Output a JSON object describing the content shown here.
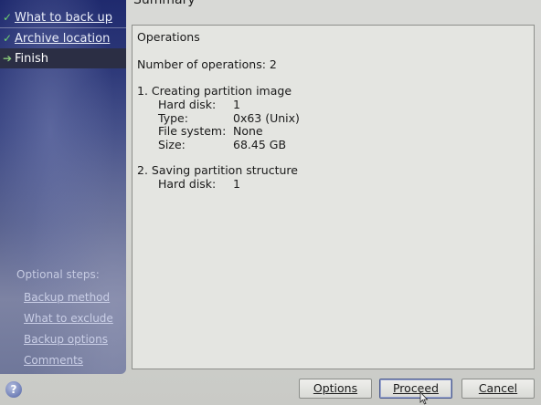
{
  "header": {
    "title": "Summary"
  },
  "sidebar": {
    "steps": [
      {
        "label": "What to back up",
        "status": "done",
        "icon": "check-icon"
      },
      {
        "label": "Archive location",
        "status": "done",
        "icon": "check-icon"
      },
      {
        "label": "Finish",
        "status": "current",
        "icon": "arrow-right-icon"
      }
    ],
    "optional_title": "Optional steps:",
    "optional_links": [
      {
        "label": "Backup method"
      },
      {
        "label": "What to exclude"
      },
      {
        "label": "Backup options"
      },
      {
        "label": "Comments"
      }
    ]
  },
  "summary": {
    "heading": "Operations",
    "count_line": "Number of operations: 2",
    "operations": [
      {
        "title": "1. Creating partition image",
        "details": [
          {
            "label": "Hard disk:",
            "value": "1"
          },
          {
            "label": "Type:",
            "value": "0x63 (Unix)"
          },
          {
            "label": "File system:",
            "value": "None"
          },
          {
            "label": "Size:",
            "value": "68.45 GB"
          }
        ]
      },
      {
        "title": "2. Saving partition structure",
        "details": [
          {
            "label": "Hard disk:",
            "value": "1"
          }
        ]
      }
    ]
  },
  "buttons": {
    "help_symbol": "?",
    "options": "Options",
    "proceed": "Proceed",
    "cancel": "Cancel"
  },
  "colors": {
    "sidebar_top": "#1f2a6e",
    "sidebar_bottom": "#6f779a",
    "check": "#6fd36f",
    "panel_bg": "#e4e5e1"
  }
}
